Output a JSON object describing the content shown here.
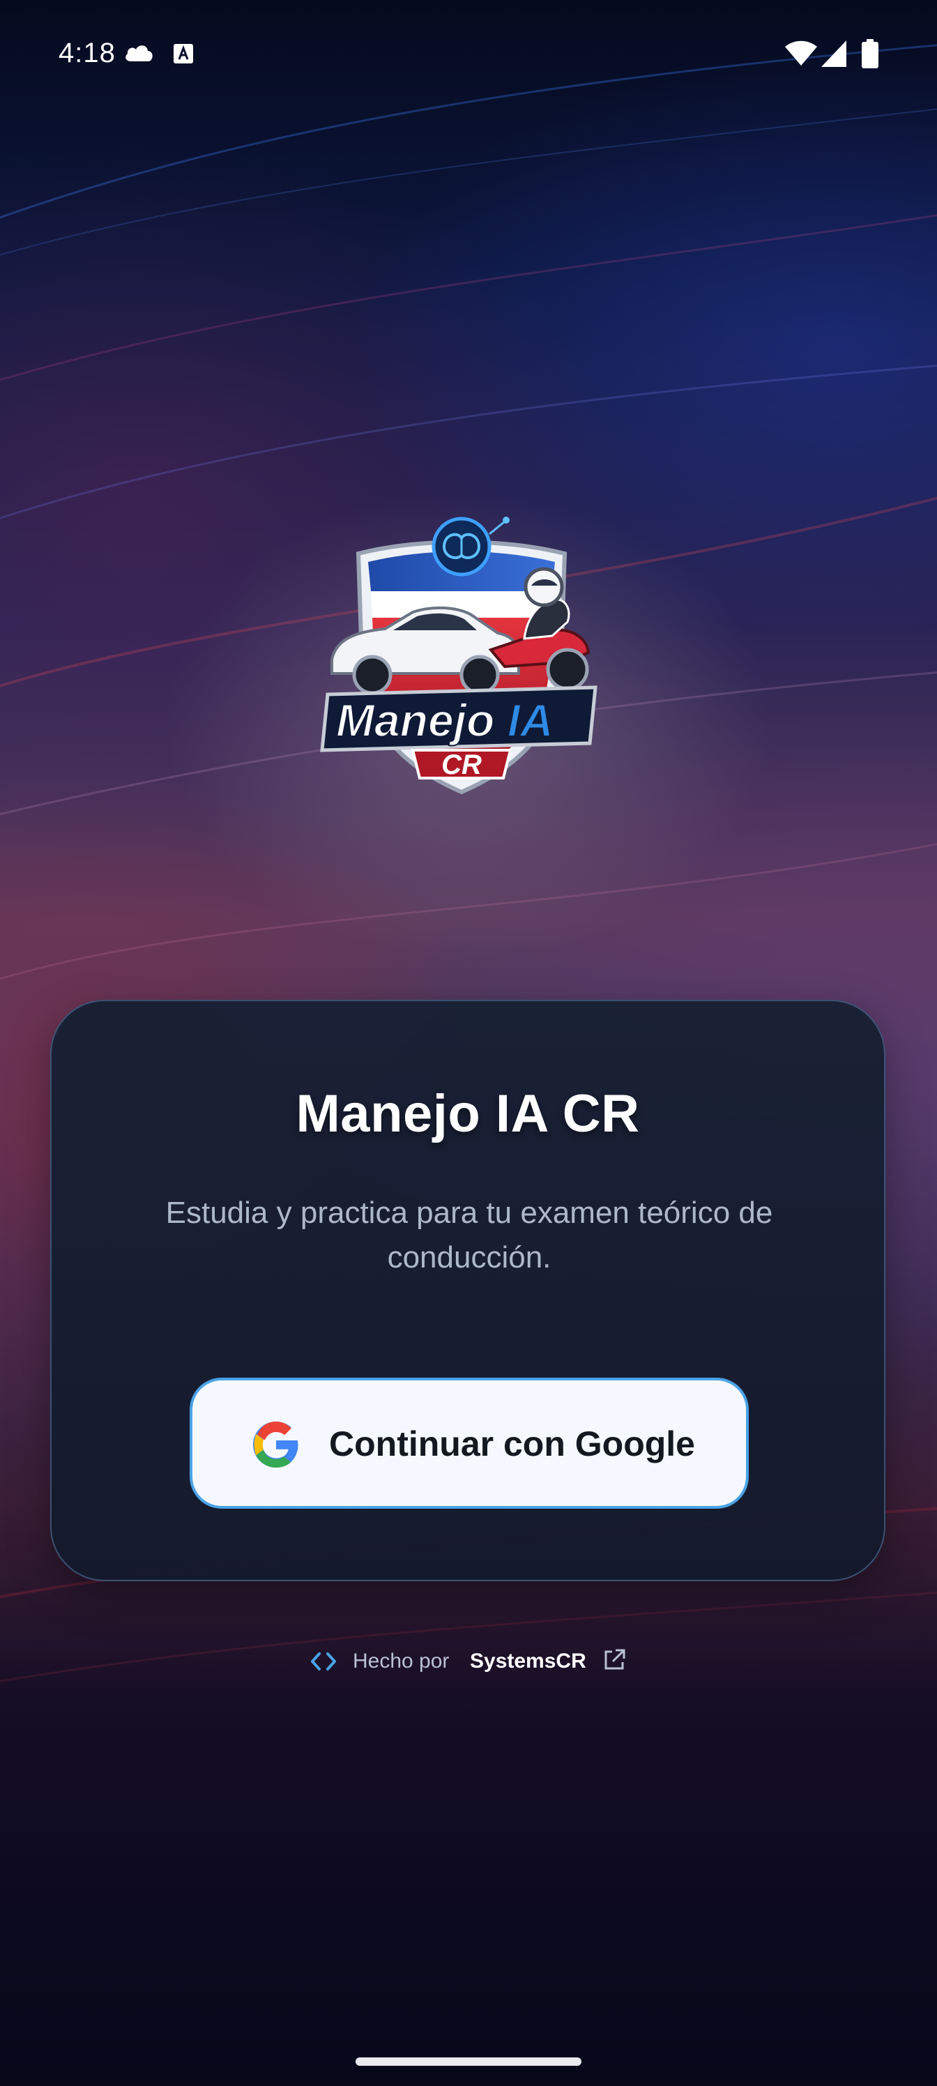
{
  "status_bar": {
    "time": "4:18",
    "icons_left": [
      "cloud-icon",
      "a-badge-icon"
    ],
    "icons_right": [
      "wifi-icon",
      "cellular-signal-icon",
      "battery-icon"
    ]
  },
  "logo": {
    "wordmark": "Manejo IA",
    "wordmark_accent": "IA",
    "badge_text": "CR"
  },
  "card": {
    "title": "Manejo IA CR",
    "subtitle": "Estudia y practica para tu examen teórico de conducción.",
    "google_button_label": "Continuar con Google"
  },
  "footer": {
    "prefix": "Hecho por",
    "brand": "SystemsCR",
    "icons": [
      "code-icon",
      "external-link-icon"
    ]
  },
  "colors": {
    "card_background": "#18203a",
    "card_border": "#3f5b82",
    "button_background": "#f5f9ff",
    "button_border": "#4aa3e6",
    "accent_blue": "#2e8be6",
    "shield_red": "#d8283a"
  }
}
